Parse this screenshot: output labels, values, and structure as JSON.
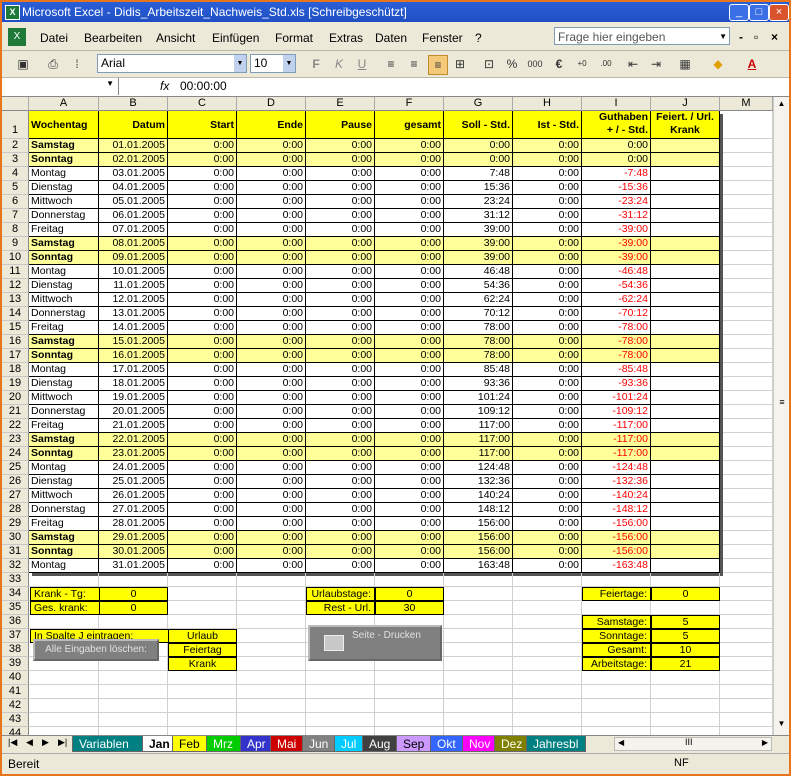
{
  "window": {
    "title": "Microsoft Excel - Didis_Arbeitszeit_Nachweis_Std.xls  [Schreibgeschützt]",
    "app_icon": "excel-icon"
  },
  "menu": {
    "items": [
      "Datei",
      "Bearbeiten",
      "Ansicht",
      "Einfügen",
      "Format",
      "Extras",
      "Daten",
      "Fenster",
      "?"
    ],
    "help_placeholder": "Frage hier eingeben"
  },
  "toolbar": {
    "font": "Arial",
    "size": "10"
  },
  "formula": {
    "name_box": "",
    "fx_label": "fx",
    "value": "00:00:00"
  },
  "columns": [
    "A",
    "B",
    "C",
    "D",
    "E",
    "F",
    "G",
    "H",
    "I",
    "J",
    "M"
  ],
  "header": {
    "a": "Wochentag",
    "b": "Datum",
    "c": "Start",
    "d": "Ende",
    "e": "Pause",
    "f": "gesamt",
    "g": "Soll - Std.",
    "h": "Ist - Std.",
    "i1": "Guthaben",
    "i2": "+ / - Std.",
    "j1": "Feiert. / Url.",
    "j2": "Krank"
  },
  "rows": [
    {
      "n": "2",
      "day": "Samstag",
      "date": "01.01.2005",
      "soll": "0:00",
      "guth": "0:00",
      "we": true
    },
    {
      "n": "3",
      "day": "Sonntag",
      "date": "02.01.2005",
      "soll": "0:00",
      "guth": "0:00",
      "we": true
    },
    {
      "n": "4",
      "day": "Montag",
      "date": "03.01.2005",
      "soll": "7:48",
      "guth": "-7:48",
      "we": false
    },
    {
      "n": "5",
      "day": "Dienstag",
      "date": "04.01.2005",
      "soll": "15:36",
      "guth": "-15:36",
      "we": false
    },
    {
      "n": "6",
      "day": "Mittwoch",
      "date": "05.01.2005",
      "soll": "23:24",
      "guth": "-23:24",
      "we": false
    },
    {
      "n": "7",
      "day": "Donnerstag",
      "date": "06.01.2005",
      "soll": "31:12",
      "guth": "-31:12",
      "we": false
    },
    {
      "n": "8",
      "day": "Freitag",
      "date": "07.01.2005",
      "soll": "39:00",
      "guth": "-39:00",
      "we": false
    },
    {
      "n": "9",
      "day": "Samstag",
      "date": "08.01.2005",
      "soll": "39:00",
      "guth": "-39:00",
      "we": true
    },
    {
      "n": "10",
      "day": "Sonntag",
      "date": "09.01.2005",
      "soll": "39:00",
      "guth": "-39:00",
      "we": true
    },
    {
      "n": "11",
      "day": "Montag",
      "date": "10.01.2005",
      "soll": "46:48",
      "guth": "-46:48",
      "we": false
    },
    {
      "n": "12",
      "day": "Dienstag",
      "date": "11.01.2005",
      "soll": "54:36",
      "guth": "-54:36",
      "we": false
    },
    {
      "n": "13",
      "day": "Mittwoch",
      "date": "12.01.2005",
      "soll": "62:24",
      "guth": "-62:24",
      "we": false
    },
    {
      "n": "14",
      "day": "Donnerstag",
      "date": "13.01.2005",
      "soll": "70:12",
      "guth": "-70:12",
      "we": false
    },
    {
      "n": "15",
      "day": "Freitag",
      "date": "14.01.2005",
      "soll": "78:00",
      "guth": "-78:00",
      "we": false
    },
    {
      "n": "16",
      "day": "Samstag",
      "date": "15.01.2005",
      "soll": "78:00",
      "guth": "-78:00",
      "we": true
    },
    {
      "n": "17",
      "day": "Sonntag",
      "date": "16.01.2005",
      "soll": "78:00",
      "guth": "-78:00",
      "we": true
    },
    {
      "n": "18",
      "day": "Montag",
      "date": "17.01.2005",
      "soll": "85:48",
      "guth": "-85:48",
      "we": false
    },
    {
      "n": "19",
      "day": "Dienstag",
      "date": "18.01.2005",
      "soll": "93:36",
      "guth": "-93:36",
      "we": false
    },
    {
      "n": "20",
      "day": "Mittwoch",
      "date": "19.01.2005",
      "soll": "101:24",
      "guth": "-101:24",
      "we": false
    },
    {
      "n": "21",
      "day": "Donnerstag",
      "date": "20.01.2005",
      "soll": "109:12",
      "guth": "-109:12",
      "we": false
    },
    {
      "n": "22",
      "day": "Freitag",
      "date": "21.01.2005",
      "soll": "117:00",
      "guth": "-117:00",
      "we": false
    },
    {
      "n": "23",
      "day": "Samstag",
      "date": "22.01.2005",
      "soll": "117:00",
      "guth": "-117:00",
      "we": true
    },
    {
      "n": "24",
      "day": "Sonntag",
      "date": "23.01.2005",
      "soll": "117:00",
      "guth": "-117:00",
      "we": true
    },
    {
      "n": "25",
      "day": "Montag",
      "date": "24.01.2005",
      "soll": "124:48",
      "guth": "-124:48",
      "we": false
    },
    {
      "n": "26",
      "day": "Dienstag",
      "date": "25.01.2005",
      "soll": "132:36",
      "guth": "-132:36",
      "we": false
    },
    {
      "n": "27",
      "day": "Mittwoch",
      "date": "26.01.2005",
      "soll": "140:24",
      "guth": "-140:24",
      "we": false
    },
    {
      "n": "28",
      "day": "Donnerstag",
      "date": "27.01.2005",
      "soll": "148:12",
      "guth": "-148:12",
      "we": false
    },
    {
      "n": "29",
      "day": "Freitag",
      "date": "28.01.2005",
      "soll": "156:00",
      "guth": "-156:00",
      "we": false
    },
    {
      "n": "30",
      "day": "Samstag",
      "date": "29.01.2005",
      "soll": "156:00",
      "guth": "-156:00",
      "we": true
    },
    {
      "n": "31",
      "day": "Sonntag",
      "date": "30.01.2005",
      "soll": "156:00",
      "guth": "-156:00",
      "we": true
    },
    {
      "n": "32",
      "day": "Montag",
      "date": "31.01.2005",
      "soll": "163:48",
      "guth": "-163:48",
      "we": false
    }
  ],
  "zero_time": "0:00",
  "lower_rows": [
    "33",
    "34",
    "35",
    "36",
    "37",
    "38",
    "39",
    "40",
    "41",
    "42",
    "43",
    "44"
  ],
  "summary": {
    "krank_tg_label": "Krank - Tg:",
    "krank_tg_value": "0",
    "ges_krank_label": "Ges. krank:",
    "ges_krank_value": "0",
    "urlaub_label": "Urlaubstage:",
    "urlaub_value": "0",
    "rest_url_label": "Rest - Url.",
    "rest_url_value": "30",
    "feiertage_label": "Feiertage:",
    "feiertage_value": "0",
    "samstage_label": "Samstage:",
    "samstage_value": "5",
    "sonntage_label": "Sonntage:",
    "sonntage_value": "5",
    "gesamt_label": "Gesamt:",
    "gesamt_value": "10",
    "arbeitstage_label": "Arbeitstage:",
    "arbeitstage_value": "21",
    "spalte_note": "In Spalte   J  eintragen:",
    "urlaub_opt": "Urlaub",
    "feiertag_opt": "Feiertag",
    "krank_opt": "Krank",
    "clear_button": "Alle Eingaben löschen:",
    "print_button": "Seite - Drucken"
  },
  "tabs": [
    {
      "label": "Variablen",
      "bg": "#008080",
      "fg": "#ffffff"
    },
    {
      "label": "Jan",
      "bg": "#ffffff",
      "fg": "#000000",
      "active": true
    },
    {
      "label": "Feb",
      "bg": "#ffff00",
      "fg": "#000000"
    },
    {
      "label": "Mrz",
      "bg": "#00cc00",
      "fg": "#ffffff"
    },
    {
      "label": "Apr",
      "bg": "#3333cc",
      "fg": "#ffffff"
    },
    {
      "label": "Mai",
      "bg": "#cc0000",
      "fg": "#ffffff"
    },
    {
      "label": "Jun",
      "bg": "#808080",
      "fg": "#ffffff"
    },
    {
      "label": "Jul",
      "bg": "#00ccff",
      "fg": "#ffffff"
    },
    {
      "label": "Aug",
      "bg": "#404040",
      "fg": "#ffffff"
    },
    {
      "label": "Sep",
      "bg": "#cc99ff",
      "fg": "#000000"
    },
    {
      "label": "Okt",
      "bg": "#3366ff",
      "fg": "#ffffff"
    },
    {
      "label": "Nov",
      "bg": "#ff00ff",
      "fg": "#ffffff"
    },
    {
      "label": "Dez",
      "bg": "#808000",
      "fg": "#ffffff"
    },
    {
      "label": "Jahresbl",
      "bg": "#008080",
      "fg": "#ffffff"
    }
  ],
  "status": {
    "text": "Bereit",
    "nf": "NF"
  },
  "colors": {
    "header_yellow": "#ffff00",
    "weekend_yellow": "#ffff99",
    "negative_red": "#ff0000",
    "window_border": "#e8741c"
  }
}
